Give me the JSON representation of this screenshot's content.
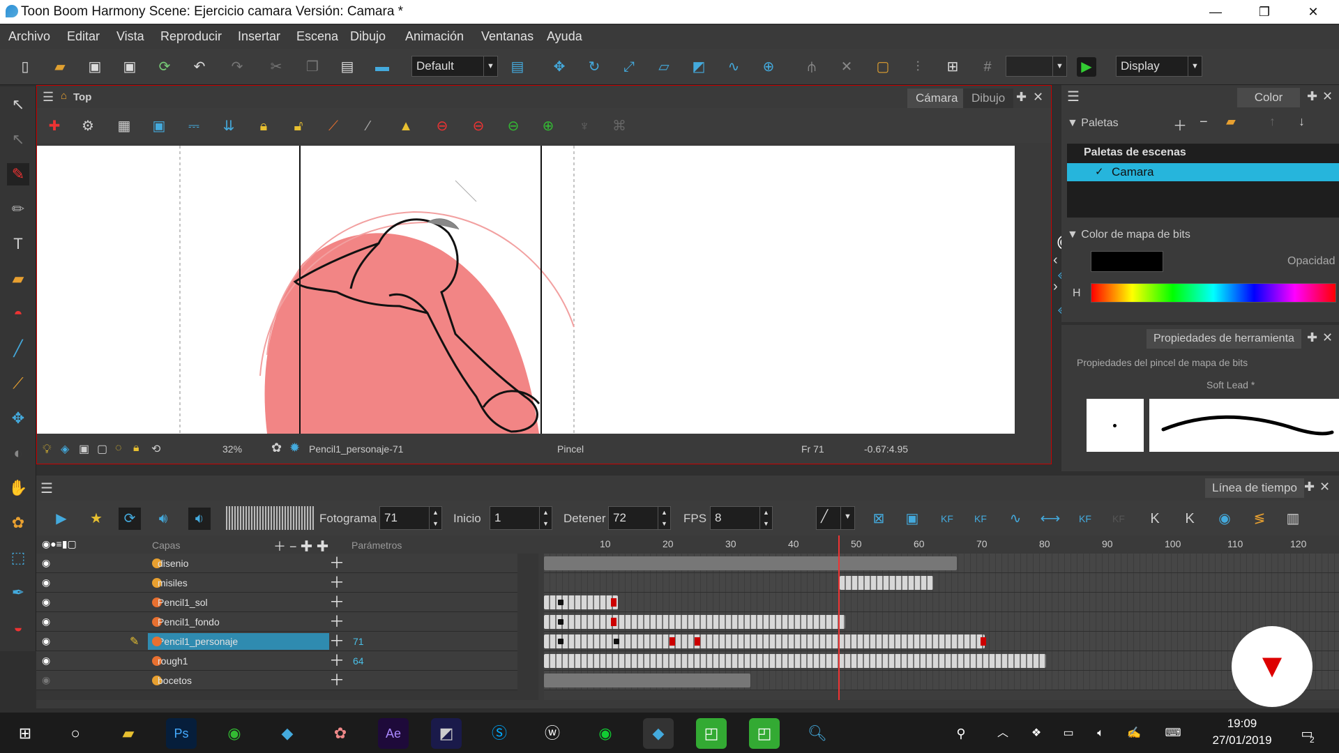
{
  "window": {
    "title": "Toon Boom Harmony Scene: Ejercicio camara Versión: Camara *",
    "min": "—",
    "max": "❐",
    "close": "✕"
  },
  "menu": [
    "Archivo",
    "Editar",
    "Vista",
    "Reproducir",
    "Insertar",
    "Escena",
    "Dibujo",
    "Animación",
    "Ventanas",
    "Ayuda"
  ],
  "toolbar": {
    "workspace": "Default",
    "display": "Display"
  },
  "viewer": {
    "location": "Top",
    "tab_camera": "Cámara",
    "tab_drawing": "Dibujo",
    "zoom": "32%",
    "drawing": "Pencil1_personaje-71",
    "tool": "Pincel",
    "frame": "Fr 71",
    "coords": "-0.67:4.95"
  },
  "color_panel": {
    "tab": "Color",
    "palettes_label": "Paletas",
    "scene_palettes": "Paletas de escenas",
    "palette_item": "Camara",
    "bitmap_color": "Color de mapa de bits",
    "opacity": "Opacidad",
    "h": "H",
    "swatch_color": "#000000"
  },
  "tool_props": {
    "tab": "Propiedades de herramienta",
    "brush_props": "Propiedades del pincel de mapa de bits",
    "preset": "Soft Lead *"
  },
  "timeline": {
    "tab": "Línea de tiempo",
    "frame_label": "Fotograma",
    "frame_value": "71",
    "start_label": "Inicio",
    "start_value": "1",
    "stop_label": "Detener",
    "stop_value": "72",
    "fps_label": "FPS",
    "fps_value": "8",
    "layers_header": "Capas",
    "params_header": "Parámetros",
    "kf1": "KF",
    "kf2": "KF",
    "kf3": "KF",
    "kf4": "KF",
    "ruler": [
      "10",
      "20",
      "30",
      "40",
      "50",
      "60",
      "70",
      "80",
      "90",
      "100",
      "110",
      "120"
    ],
    "layers": [
      {
        "name": "disenio",
        "param": "",
        "color": "#e8a030"
      },
      {
        "name": "misiles",
        "param": "",
        "color": "#e8a030"
      },
      {
        "name": "Pencil1_sol",
        "param": "",
        "color": "#e87030"
      },
      {
        "name": "Pencil1_fondo",
        "param": "",
        "color": "#e87030"
      },
      {
        "name": "Pencil1_personaje",
        "param": "71",
        "color": "#e87030"
      },
      {
        "name": "rough1",
        "param": "64",
        "color": "#e87030"
      },
      {
        "name": "bocetos",
        "param": "",
        "color": "#e8a030"
      }
    ]
  },
  "taskbar": {
    "time": "19:09",
    "date": "27/01/2019",
    "notif": "2"
  }
}
